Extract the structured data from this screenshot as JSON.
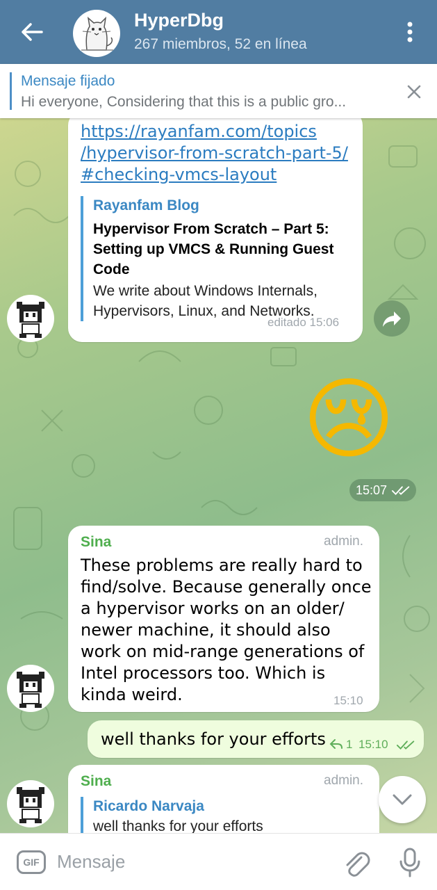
{
  "header": {
    "title": "HyperDbg",
    "subtitle": "267 miembros, 52 en línea",
    "back_icon": "arrow-left-icon",
    "menu_icon": "more-vertical-icon"
  },
  "pinned": {
    "title": "Mensaje fijado",
    "text": "Hi everyone,  Considering that this is a public gro..."
  },
  "messages": {
    "link_msg": {
      "link_lines": [
        "https://rayanfam.com/topics",
        "/hypervisor-from-scratch-part-5/",
        "#checking-vmcs-layout"
      ],
      "preview_site": "Rayanfam Blog",
      "preview_title": "Hypervisor From Scratch – Part 5: Setting up VMCS & Running Guest Code",
      "preview_desc": "We write about Windows Internals, Hypervisors, Linux, and Networks.",
      "time": "editado 15:06"
    },
    "emoji_msg": {
      "emoji": "😢",
      "time": "15:07"
    },
    "sina_msg": {
      "sender": "Sina",
      "badge": "admin.",
      "text": "These problems are really hard to find/solve. Because generally once a hypervisor works on an older/ newer machine, it should also work on mid-range generations of Intel processors too. Which is kinda weird.",
      "time": "15:10"
    },
    "thanks_msg": {
      "text": "well thanks for your efforts",
      "replies": "1",
      "time": "15:10"
    },
    "reply_msg": {
      "sender": "Sina",
      "badge": "admin.",
      "quote_author": "Ricardo Narvaja",
      "quote_text": "well thanks for your efforts"
    }
  },
  "input": {
    "gif_label": "GIF",
    "placeholder": "Mensaje"
  },
  "colors": {
    "header": "#517da2",
    "link": "#2b7cc0",
    "sender": "#4fae4e",
    "outgoing_bubble": "#effdde"
  }
}
